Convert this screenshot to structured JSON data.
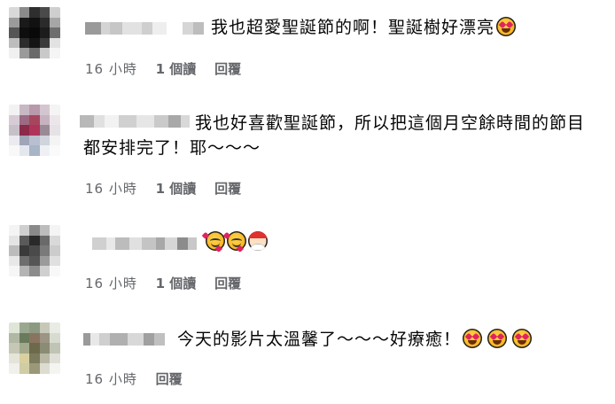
{
  "comments": [
    {
      "text": "我也超愛聖誕節的啊！聖誕樹好漂亮",
      "emojis": [
        "heart-eyes-emoji"
      ],
      "time": "16 小時",
      "reads": "1 個讀",
      "reply": "回覆",
      "avatar_colors": [
        "#d9d9d9",
        "#8a8a8a",
        "#2e2e2e",
        "#4a4a4a",
        "#cfcfcf",
        "#9b9b9b",
        "#1a1a1a",
        "#111111",
        "#2b2b2b",
        "#a6a6a6",
        "#555555",
        "#0e0e0e",
        "#090909",
        "#1c1c1c",
        "#6e6e6e",
        "#bdbdbd",
        "#2c2c2c",
        "#151515",
        "#3a3a3a",
        "#e2e2e2",
        "#f0f0f0",
        "#9a9a9a",
        "#6a6a6a",
        "#c9c9c9",
        "#f5f5f5"
      ]
    },
    {
      "text_line1": "我也好喜歡聖誕節，所以把這個月空餘時間的節目",
      "text_line2": "都安排完了！耶～～～",
      "time": "16 小時",
      "reads": "1 個讀",
      "reply": "回覆",
      "avatar_colors": [
        "#f2f2f2",
        "#c8b8c4",
        "#b89aac",
        "#d4c6d0",
        "#f4f4f4",
        "#d7ccd6",
        "#9c6a82",
        "#a7455f",
        "#c7b2c0",
        "#ece6ea",
        "#c8c0c8",
        "#8c2a4a",
        "#b0335a",
        "#9a8a96",
        "#e6e2e6",
        "#eaeaf0",
        "#a0a6b8",
        "#b8c0d0",
        "#d0d4dc",
        "#f4f4f4",
        "#f8f8f8",
        "#e4e8ee",
        "#a8b4c8",
        "#eef0f4",
        "#fafafa"
      ]
    },
    {
      "emojis": [
        "smile-hearts-emoji",
        "smile-hearts-emoji",
        "santa-emoji"
      ],
      "time": "16 小時",
      "reads": "1 個讀",
      "reply": "回覆",
      "avatar_colors": [
        "#f4f4f4",
        "#cfcfcf",
        "#8a8a8a",
        "#bdbdbd",
        "#f4f4f4",
        "#e4e4e4",
        "#5a5a5a",
        "#2a2a2a",
        "#6a6a6a",
        "#d9d9d9",
        "#bcbcbc",
        "#3a3a3a",
        "#4a4a4a",
        "#7a7a7a",
        "#cccccc",
        "#e8e8e8",
        "#6e6e6e",
        "#555555",
        "#9a9a9a",
        "#e0e0e0",
        "#f6f6f6",
        "#b4b4b4",
        "#8c8c8c",
        "#cfcfcf",
        "#f8f8f8"
      ]
    },
    {
      "text": "今天的影片太溫馨了～～～好療癒！",
      "emojis": [
        "heart-eyes-emoji",
        "heart-eyes-emoji",
        "heart-eyes-emoji"
      ],
      "time": "16 小時",
      "reply": "回覆",
      "avatar_colors": [
        "#dfe6d8",
        "#9aa890",
        "#8c9a82",
        "#c7c8b8",
        "#e8ece4",
        "#b0b8a4",
        "#6a7a5c",
        "#8a7460",
        "#9c9484",
        "#d8dcd0",
        "#c4c8b4",
        "#a4a88c",
        "#6c6a4a",
        "#8a8c74",
        "#c0c4b4",
        "#e4e4d8",
        "#d8d0a0",
        "#7c7a5c",
        "#b8b8a4",
        "#e0e0d8",
        "#f0f0ec",
        "#d0cca4",
        "#9a9878",
        "#dcdcd0",
        "#f4f4f0"
      ]
    }
  ],
  "name_blur_colors": [
    "#9a9a9a",
    "#d4d4d4",
    "#bfbfbf",
    "#e8e8e8",
    "#a8a8a8",
    "#cccccc",
    "#b4b4b4",
    "#dedede"
  ]
}
